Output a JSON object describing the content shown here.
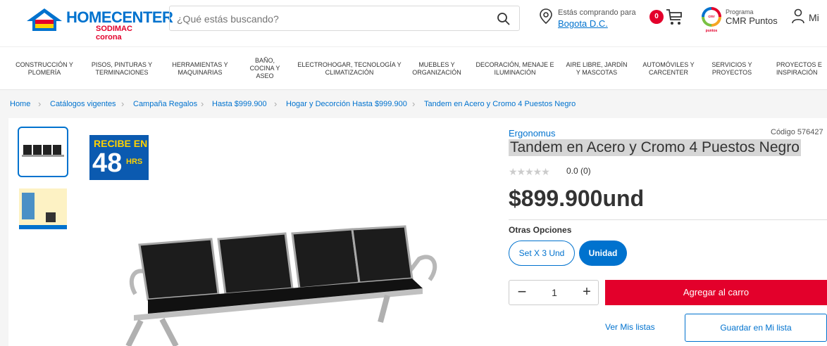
{
  "header": {
    "logo_text": "HOMECENTER",
    "logo_sub": "SODIMAC corona",
    "search_placeholder": "¿Qué estás buscando?",
    "location_label": "Estás comprando para",
    "location_value": "Bogota D.C.",
    "cart_count": "0",
    "cmr_label": "Programa",
    "cmr_value": "CMR Puntos",
    "cmr_logo_text": "cmr puntos",
    "user_label": "Mi",
    "accent_color": "#0072ce",
    "brand_red": "#e3002b"
  },
  "nav": {
    "items": [
      "Construcción y plomería",
      "Pisos, pinturas y terminaciones",
      "Herramientas y maquinarias",
      "Baño, cocina y aseo",
      "Electrohogar, tecnología y climatización",
      "Muebles y organización",
      "Decoración, menaje e iluminación",
      "Aire libre, jardín y mascotas",
      "Automóviles y carcenter",
      "Servicios y proyectos",
      "Proyectos e inspiración"
    ]
  },
  "breadcrumb": {
    "items": [
      "Home",
      "Catálogos vigentes",
      "Campaña Regalos",
      "Hasta $999.900",
      "Hogar y Decorción Hasta $999.900",
      "Tandem en Acero y Cromo 4 Puestos Negro"
    ]
  },
  "gallery": {
    "badge_top": "RECIBE EN",
    "badge_num": "48",
    "badge_unit": "HRS"
  },
  "product": {
    "brand": "Ergonomus",
    "code": "Código 576427",
    "title": "Tandem en Acero y Cromo 4 Puestos Negro",
    "stars": "★★★★★",
    "rating": "0.0 (0)",
    "price": "$899.900und",
    "options_label": "Otras Opciones",
    "options": [
      "Set X 3 Und",
      "Unidad"
    ],
    "selected_option": "Unidad",
    "qty_minus": "−",
    "quantity": "1",
    "qty_plus": "+",
    "add_to_cart": "Agregar al carro",
    "my_lists": "Ver Mis listas",
    "save_list": "Guardar en Mi lista"
  }
}
